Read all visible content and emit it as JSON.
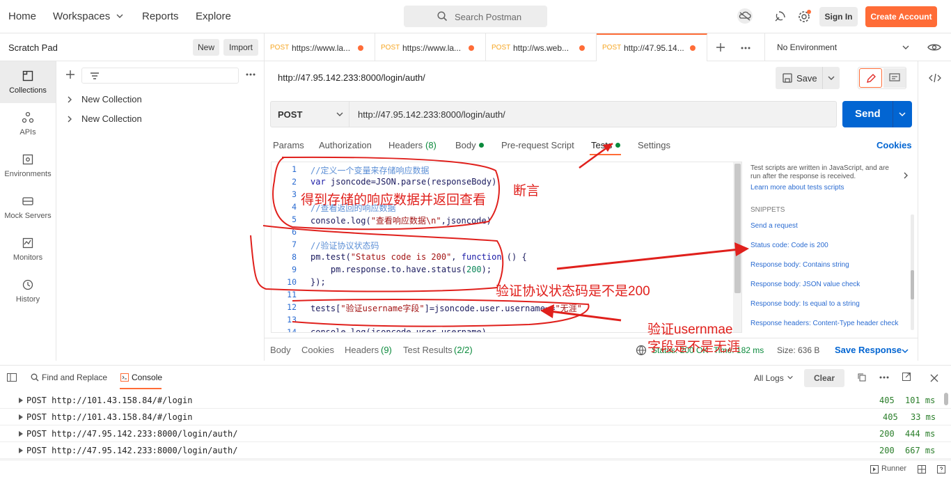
{
  "topnav": {
    "home": "Home",
    "workspaces": "Workspaces",
    "reports": "Reports",
    "explore": "Explore",
    "search_placeholder": "Search Postman",
    "signin": "Sign In",
    "create": "Create Account"
  },
  "sidebar": {
    "title": "Scratch Pad",
    "new_btn": "New",
    "import_btn": "Import",
    "nav": [
      {
        "label": "Collections",
        "icon": "collections-icon"
      },
      {
        "label": "APIs",
        "icon": "apis-icon"
      },
      {
        "label": "Environments",
        "icon": "environments-icon"
      },
      {
        "label": "Mock Servers",
        "icon": "mock-servers-icon"
      },
      {
        "label": "Monitors",
        "icon": "monitors-icon"
      },
      {
        "label": "History",
        "icon": "history-icon"
      }
    ],
    "collections": [
      "New Collection",
      "New Collection"
    ]
  },
  "tabs": [
    {
      "method": "POST",
      "url": "https://www.la..."
    },
    {
      "method": "POST",
      "url": "https://www.la..."
    },
    {
      "method": "POST",
      "url": "http://ws.web..."
    },
    {
      "method": "POST",
      "url": "http://47.95.14..."
    }
  ],
  "environment": "No Environment",
  "request": {
    "title": "http://47.95.142.233:8000/login/auth/",
    "save": "Save",
    "method": "POST",
    "url": "http://47.95.142.233:8000/login/auth/",
    "send": "Send",
    "tabs": {
      "params": "Params",
      "authorization": "Authorization",
      "headers": "Headers",
      "headers_count": "(8)",
      "body": "Body",
      "prerequest": "Pre-request Script",
      "tests": "Tests",
      "settings": "Settings"
    },
    "cookies": "Cookies"
  },
  "editor": {
    "lines": [
      {
        "n": "1",
        "parts": [
          [
            "cm",
            "//定义一个变量来存储响应数据"
          ]
        ]
      },
      {
        "n": "2",
        "parts": [
          [
            "kw",
            "var "
          ],
          [
            "def",
            "jsoncode=JSON.parse(responseBody)"
          ]
        ]
      },
      {
        "n": "3",
        "parts": []
      },
      {
        "n": "4",
        "parts": [
          [
            "cm",
            "//查看返回的响应数据"
          ]
        ]
      },
      {
        "n": "5",
        "parts": [
          [
            "def",
            "console.log("
          ],
          [
            "st",
            "\"查看响应数据\\n\""
          ],
          [
            "def",
            ",jsoncode)"
          ]
        ]
      },
      {
        "n": "6",
        "parts": []
      },
      {
        "n": "7",
        "parts": [
          [
            "cm",
            "//验证协议状态码"
          ]
        ]
      },
      {
        "n": "8",
        "parts": [
          [
            "def",
            "pm.test("
          ],
          [
            "st",
            "\"Status code is 200\""
          ],
          [
            "def",
            ", "
          ],
          [
            "kw",
            "function"
          ],
          [
            "def",
            " () {"
          ]
        ]
      },
      {
        "n": "9",
        "parts": [
          [
            "def",
            "    pm.response.to.have.status("
          ],
          [
            "num",
            "200"
          ],
          [
            "def",
            ");"
          ]
        ]
      },
      {
        "n": "10",
        "parts": [
          [
            "def",
            "});"
          ]
        ]
      },
      {
        "n": "11",
        "parts": []
      },
      {
        "n": "12",
        "parts": [
          [
            "def",
            "tests["
          ],
          [
            "st",
            "\"验证username字段\""
          ],
          [
            "def",
            "]=jsoncode.user.username=="
          ],
          [
            "st",
            "\"无涯\""
          ]
        ]
      },
      {
        "n": "13",
        "parts": []
      },
      {
        "n": "14",
        "parts": [
          [
            "def",
            "console.log(jsoncode.user.username)"
          ]
        ]
      }
    ]
  },
  "snippets": {
    "intro": "Test scripts are written in JavaScript, and are run after the response is received.",
    "learn": "Learn more about tests scripts",
    "heading": "SNIPPETS",
    "items": [
      "Send a request",
      "Status code: Code is 200",
      "Response body: Contains string",
      "Response body: JSON value check",
      "Response body: Is equal to a string",
      "Response headers: Content-Type header check"
    ]
  },
  "response": {
    "body": "Body",
    "cookies": "Cookies",
    "headers": "Headers",
    "headers_count": "(9)",
    "test_results": "Test Results",
    "test_count": "(2/2)",
    "status": "Status: 200 OK",
    "time": "Time: 182 ms",
    "size": "Size: 636 B",
    "save": "Save Response"
  },
  "console": {
    "find_replace": "Find and Replace",
    "console_tab": "Console",
    "all_logs": "All Logs",
    "clear": "Clear",
    "rows": [
      {
        "text": "POST http://101.43.158.84/#/login",
        "status": "405",
        "time": "101 ms"
      },
      {
        "text": "POST http://101.43.158.84/#/login",
        "status": "405",
        "time": "33 ms"
      },
      {
        "text": "POST http://47.95.142.233:8000/login/auth/",
        "status": "200",
        "time": "444 ms"
      },
      {
        "text": "POST http://47.95.142.233:8000/login/auth/",
        "status": "200",
        "time": "667 ms"
      }
    ]
  },
  "statusbar": {
    "runner": "Runner"
  },
  "annotations": {
    "a1": "得到存储的响应数据并返回查看",
    "a2": "断言",
    "a3": "验证协议状态码是不是200",
    "a4a": "验证usernmae",
    "a4b": "字段是不是无涯"
  },
  "colors": {
    "accent": "#ff6c37",
    "send": "#0265d2",
    "annotation": "#e0201c",
    "success": "#0b8a3c"
  }
}
